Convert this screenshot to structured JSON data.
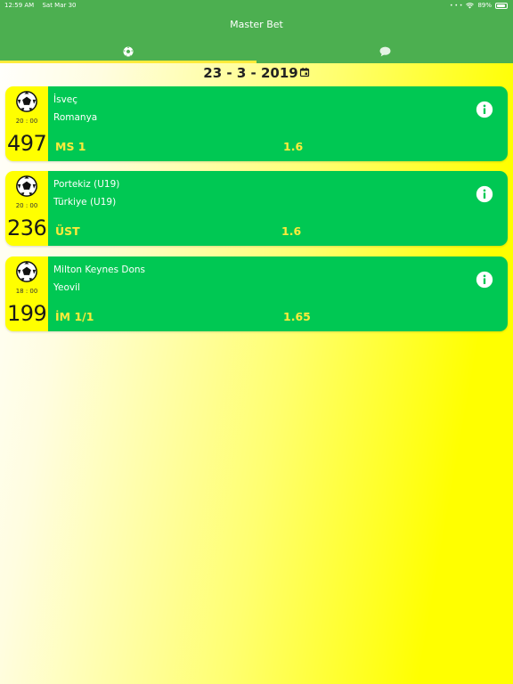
{
  "status_bar": {
    "time": "12:59 AM",
    "date": "Sat Mar 30",
    "battery": "89%",
    "battery_level": 0.89
  },
  "header": {
    "title": "Master Bet",
    "tabs": [
      {
        "icon": "soccer-ball-icon",
        "active": true
      },
      {
        "icon": "chat-bubble-icon",
        "active": false
      }
    ]
  },
  "date": {
    "label": "23 - 3 - 2019"
  },
  "colors": {
    "header_bg": "#4caf50",
    "card_green": "#00c853",
    "card_yellow": "#ffff00",
    "accent_yellow": "#ffeb3b"
  },
  "matches": [
    {
      "id": "497",
      "time": "20 : 00",
      "home": "İsveç",
      "away": "Romanya",
      "pick": "MS 1",
      "odd": "1.6"
    },
    {
      "id": "236",
      "time": "20 : 00",
      "home": "Portekiz (U19)",
      "away": "Türkiye (U19)",
      "pick": "ÜST",
      "odd": "1.6"
    },
    {
      "id": "199",
      "time": "18 : 00",
      "home": "Milton Keynes Dons",
      "away": "Yeovil",
      "pick": "İM 1/1",
      "odd": "1.65"
    }
  ]
}
